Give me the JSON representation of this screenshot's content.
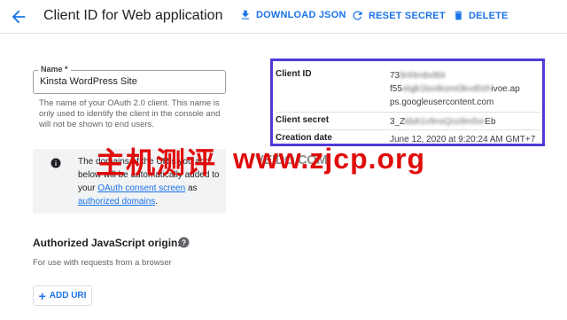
{
  "header": {
    "back_icon": "arrow-back-icon",
    "title": "Client ID for Web application",
    "actions": [
      {
        "label": "DOWNLOAD JSON",
        "icon": "download-icon"
      },
      {
        "label": "RESET SECRET",
        "icon": "refresh-icon"
      },
      {
        "label": "DELETE",
        "icon": "trash-icon"
      }
    ]
  },
  "name_field": {
    "label": "Name *",
    "value": "Kinsta WordPress Site",
    "help": "The name of your OAuth 2.0 client. This name is only used to identify the client in the console and will not be shown to end users."
  },
  "info_box": {
    "icon": "info-icon",
    "text_before": "The domains of the URIs you add below will be automatically added to your ",
    "link1": "OAuth consent screen",
    "text_mid": " as ",
    "link2": "authorized domains",
    "text_after": "."
  },
  "details": {
    "rows": [
      {
        "key": "Client ID",
        "lines": [
          "73",
          "f55",
          "ivoe.ap",
          "ps.googleusercontent.com"
        ]
      },
      {
        "key": "Client secret",
        "value": "3_Z",
        "value_end": "Eb"
      },
      {
        "key": "Creation date",
        "value": "June 12, 2020 at 9:20:24 AM GMT+7"
      }
    ],
    "border_color": "#4d3bd6"
  },
  "watermark": {
    "chinese": "主机测评",
    "url": "www.zjcp.org",
    "dark_text": "VEIDO.COM",
    "color": "#e00000"
  },
  "js_origins": {
    "title": "Authorized JavaScript origins",
    "help_icon": "help-icon",
    "subtitle": "For use with requests from a browser",
    "add_button": "ADD URI",
    "add_icon": "plus-icon"
  },
  "accent_color": "#1a73e8"
}
